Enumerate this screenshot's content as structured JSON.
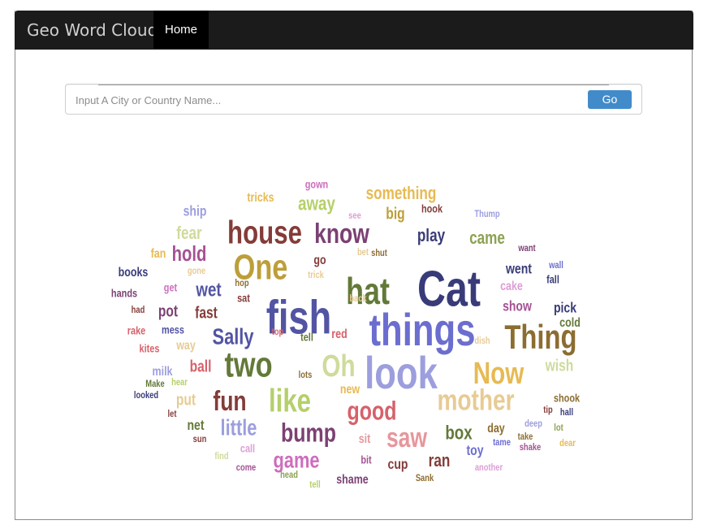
{
  "navbar": {
    "brand": "Geo Word Cloud",
    "home": "Home"
  },
  "search": {
    "placeholder": "Input A City or Country Name...",
    "button": "Go"
  },
  "colors": {
    "navbar": "#1b1b1b",
    "button": "#428bca"
  },
  "words": [
    {
      "t": "Cat",
      "c": "#393b79"
    },
    {
      "t": "fish",
      "c": "#5254a3"
    },
    {
      "t": "things",
      "c": "#6b6ecf"
    },
    {
      "t": "look",
      "c": "#9c9ede"
    },
    {
      "t": "hat",
      "c": "#637939"
    },
    {
      "t": "house",
      "c": "#843c39"
    },
    {
      "t": "One",
      "c": "#bd9e39"
    },
    {
      "t": "know",
      "c": "#7b4173"
    },
    {
      "t": "Thing",
      "c": "#8c6d31"
    },
    {
      "t": "Now",
      "c": "#e7ba52"
    },
    {
      "t": "Oh",
      "c": "#cedb9c"
    },
    {
      "t": "two",
      "c": "#637939"
    },
    {
      "t": "like",
      "c": "#b5cf6b"
    },
    {
      "t": "mother",
      "c": "#e7cb94"
    },
    {
      "t": "good",
      "c": "#d6616b"
    },
    {
      "t": "fun",
      "c": "#843c39"
    },
    {
      "t": "bump",
      "c": "#7b4173"
    },
    {
      "t": "saw",
      "c": "#e7969c"
    },
    {
      "t": "game",
      "c": "#ce6dbd"
    },
    {
      "t": "little",
      "c": "#9c9ede"
    },
    {
      "t": "Sally",
      "c": "#5254a3"
    },
    {
      "t": "hold",
      "c": "#a55194"
    },
    {
      "t": "fear",
      "c": "#cedb9c"
    },
    {
      "t": "away",
      "c": "#b5cf6b"
    },
    {
      "t": "something",
      "c": "#e7ba52"
    },
    {
      "t": "big",
      "c": "#bd9e39"
    },
    {
      "t": "play",
      "c": "#393b79"
    },
    {
      "t": "came",
      "c": "#8ca252"
    },
    {
      "t": "went",
      "c": "#393b79"
    },
    {
      "t": "cake",
      "c": "#de9ed6"
    },
    {
      "t": "show",
      "c": "#a55194"
    },
    {
      "t": "pick",
      "c": "#393b79"
    },
    {
      "t": "cold",
      "c": "#637939"
    },
    {
      "t": "wish",
      "c": "#cedb9c"
    },
    {
      "t": "shook",
      "c": "#8c6d31"
    },
    {
      "t": "box",
      "c": "#637939"
    },
    {
      "t": "day",
      "c": "#8c6d31"
    },
    {
      "t": "toy",
      "c": "#6b6ecf"
    },
    {
      "t": "ran",
      "c": "#843c39"
    },
    {
      "t": "cup",
      "c": "#843c39"
    },
    {
      "t": "shame",
      "c": "#7b4173"
    },
    {
      "t": "bit",
      "c": "#a55194"
    },
    {
      "t": "sit",
      "c": "#e7969c"
    },
    {
      "t": "new",
      "c": "#e7ba52"
    },
    {
      "t": "wet",
      "c": "#5254a3"
    },
    {
      "t": "fast",
      "c": "#843c39"
    },
    {
      "t": "pot",
      "c": "#7b4173"
    },
    {
      "t": "ball",
      "c": "#d6616b"
    },
    {
      "t": "net",
      "c": "#637939"
    },
    {
      "t": "put",
      "c": "#e7cb94"
    },
    {
      "t": "milk",
      "c": "#9c9ede"
    },
    {
      "t": "way",
      "c": "#e7cb94"
    },
    {
      "t": "kites",
      "c": "#d6616b"
    },
    {
      "t": "mess",
      "c": "#5254a3"
    },
    {
      "t": "rake",
      "c": "#d6616b"
    },
    {
      "t": "books",
      "c": "#393b79"
    },
    {
      "t": "hands",
      "c": "#7b4173"
    },
    {
      "t": "ship",
      "c": "#9c9ede"
    },
    {
      "t": "fan",
      "c": "#e7ba52"
    },
    {
      "t": "get",
      "c": "#ce6dbd"
    },
    {
      "t": "tricks",
      "c": "#e7ba52"
    },
    {
      "t": "gown",
      "c": "#ce6dbd"
    },
    {
      "t": "hook",
      "c": "#843c39"
    },
    {
      "t": "go",
      "c": "#843c39"
    },
    {
      "t": "tell",
      "c": "#637939"
    },
    {
      "t": "red",
      "c": "#d6616b"
    },
    {
      "t": "sat",
      "c": "#843c39"
    },
    {
      "t": "hop",
      "c": "#8c6d31"
    },
    {
      "t": "lots",
      "c": "#8c6d31"
    },
    {
      "t": "call",
      "c": "#de9ed6"
    },
    {
      "t": "sun",
      "c": "#843c39"
    },
    {
      "t": "find",
      "c": "#cedb9c"
    },
    {
      "t": "come",
      "c": "#a55194"
    },
    {
      "t": "head",
      "c": "#8ca252"
    },
    {
      "t": "tell",
      "c": "#b5cf6b"
    },
    {
      "t": "Sank",
      "c": "#8c6d31"
    },
    {
      "t": "another",
      "c": "#de9ed6"
    },
    {
      "t": "shake",
      "c": "#a55194"
    },
    {
      "t": "tame",
      "c": "#6b6ecf"
    },
    {
      "t": "take",
      "c": "#8c6d31"
    },
    {
      "t": "deep",
      "c": "#9c9ede"
    },
    {
      "t": "dear",
      "c": "#e7ba52"
    },
    {
      "t": "lot",
      "c": "#8ca252"
    },
    {
      "t": "hall",
      "c": "#393b79"
    },
    {
      "t": "tip",
      "c": "#843c39"
    },
    {
      "t": "fall",
      "c": "#393b79"
    },
    {
      "t": "wall",
      "c": "#6b6ecf"
    },
    {
      "t": "want",
      "c": "#7b4173"
    },
    {
      "t": "Thump",
      "c": "#9c9ede"
    },
    {
      "t": "let",
      "c": "#843c39"
    },
    {
      "t": "looked",
      "c": "#393b79"
    },
    {
      "t": "Make",
      "c": "#637939"
    },
    {
      "t": "hear",
      "c": "#b5cf6b"
    },
    {
      "t": "had",
      "c": "#843c39"
    },
    {
      "t": "see",
      "c": "#de9ed6"
    },
    {
      "t": "shut",
      "c": "#8c6d31"
    },
    {
      "t": "bet",
      "c": "#e7cb94"
    },
    {
      "t": "trick",
      "c": "#e7cb94"
    },
    {
      "t": "gone",
      "c": "#e7cb94"
    },
    {
      "t": "top",
      "c": "#d6616b"
    },
    {
      "t": "back",
      "c": "#e7cb94"
    },
    {
      "t": "dish",
      "c": "#e7cb94"
    }
  ]
}
